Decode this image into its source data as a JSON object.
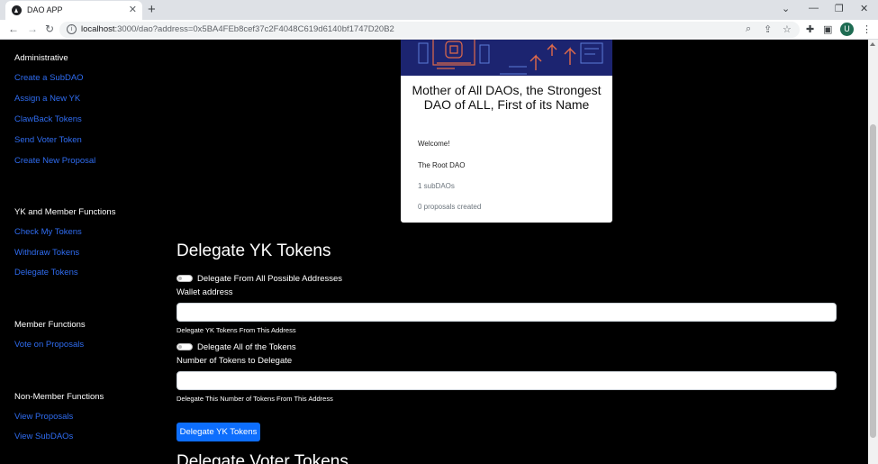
{
  "browser": {
    "tab_title": "DAO APP",
    "tab_close": "✕",
    "new_tab": "+",
    "url_host": "localhost",
    "url_rest": ":3000/dao?address=0x5BA4FEb8cef37c2F4048C619d6140bf1747D20B2",
    "profile_initial": "U",
    "icons": [
      "back-icon",
      "forward-icon",
      "reload-icon",
      "site-info-icon",
      "zoom-icon",
      "share-icon",
      "bookmark-star-icon",
      "extensions-icon",
      "side-panel-icon",
      "menu-icon",
      "minimize-icon",
      "restore-icon",
      "close-window-icon",
      "tab-search-icon"
    ]
  },
  "sidebar": {
    "administrative": {
      "heading": "Administrative",
      "links": [
        "Create a SubDAO",
        "Assign a New YK",
        "ClawBack Tokens",
        "Send Voter Token",
        "Create New Proposal"
      ]
    },
    "yk_member": {
      "heading": "YK and Member Functions",
      "links": [
        "Check My Tokens",
        "Withdraw Tokens",
        "Delegate Tokens"
      ]
    },
    "member": {
      "heading": "Member Functions",
      "links": [
        "Vote on Proposals"
      ]
    },
    "non_member": {
      "heading": "Non-Member Functions",
      "links": [
        "View Proposals",
        "View SubDAOs"
      ]
    },
    "link_color": "#2f6cf0"
  },
  "card": {
    "title": "Mother of All DAOs, the Strongest DAO of ALL, First of its Name",
    "welcome": "Welcome!",
    "subtitle": "The Root DAO",
    "subdaos": "1 subDAOs",
    "proposals": "0 proposals created",
    "banner_color": "#1c2470"
  },
  "delegate": {
    "title": "Delegate YK Tokens",
    "toggle_all_addresses": "Delegate From All Possible Addresses",
    "wallet_label": "Wallet address",
    "wallet_value": "",
    "wallet_help": "Delegate YK Tokens From This Address",
    "toggle_all_tokens": "Delegate All of the Tokens",
    "amount_label": "Number of Tokens to Delegate",
    "amount_value": "",
    "amount_help": "Delegate This Number of Tokens From This Address",
    "button": "Delegate YK Tokens",
    "button_color": "#0d6efd"
  },
  "next_section": {
    "title": "Delegate Voter Tokens"
  }
}
